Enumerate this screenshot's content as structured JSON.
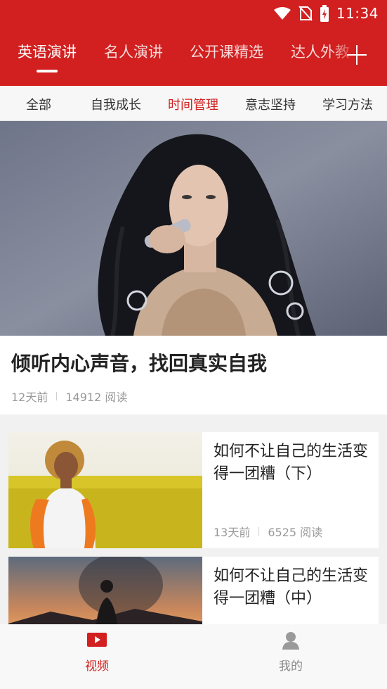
{
  "status_bar": {
    "time": "11:34",
    "icons": [
      "wifi-icon",
      "no-sim-icon",
      "battery-charging-icon"
    ]
  },
  "top_tabs": [
    {
      "label": "英语演讲",
      "active": true
    },
    {
      "label": "名人演讲",
      "active": false
    },
    {
      "label": "公开课精选",
      "active": false
    },
    {
      "label": "达人外教",
      "active": false
    }
  ],
  "add_channel_icon": "plus-icon",
  "sub_tabs": [
    {
      "label": "全部",
      "active": false
    },
    {
      "label": "自我成长",
      "active": false
    },
    {
      "label": "时间管理",
      "active": true
    },
    {
      "label": "意志坚持",
      "active": false
    },
    {
      "label": "学习方法",
      "active": false
    }
  ],
  "hero": {
    "title": "倾听内心声音，找回真实自我",
    "time_ago": "12天前",
    "reads": "14912 阅读"
  },
  "articles": [
    {
      "title": "如何不让自己的生活变得一团糟（下）",
      "time_ago": "13天前",
      "reads": "6525 阅读"
    },
    {
      "title": "如何不让自己的生活变得一团糟（中）",
      "time_ago": "",
      "reads": ""
    }
  ],
  "bottom_nav": [
    {
      "label": "视频",
      "icon": "video-play-icon",
      "active": true
    },
    {
      "label": "我的",
      "icon": "user-icon",
      "active": false
    }
  ],
  "colors": {
    "brand_red": "#d21f1f",
    "meta_gray": "#999999",
    "background": "#f1f1f1"
  }
}
